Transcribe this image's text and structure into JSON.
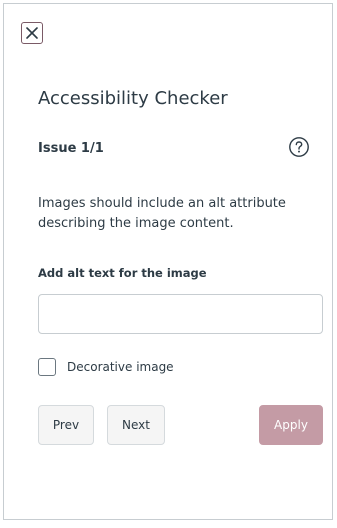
{
  "dialog": {
    "title": "Accessibility Checker",
    "close_icon": "close-icon"
  },
  "issue": {
    "counter": "Issue 1/1",
    "help_icon": "question-circle-icon",
    "message": "Images should include an alt attribute describing the image content."
  },
  "alt_text": {
    "label": "Add alt text for the image",
    "value": "",
    "placeholder": ""
  },
  "decorative": {
    "label": "Decorative image",
    "checked": false
  },
  "buttons": {
    "prev": "Prev",
    "next": "Next",
    "apply": "Apply"
  },
  "colors": {
    "apply_button": "#c49ba5",
    "text": "#2d3b45",
    "border": "#c7cdd1"
  }
}
